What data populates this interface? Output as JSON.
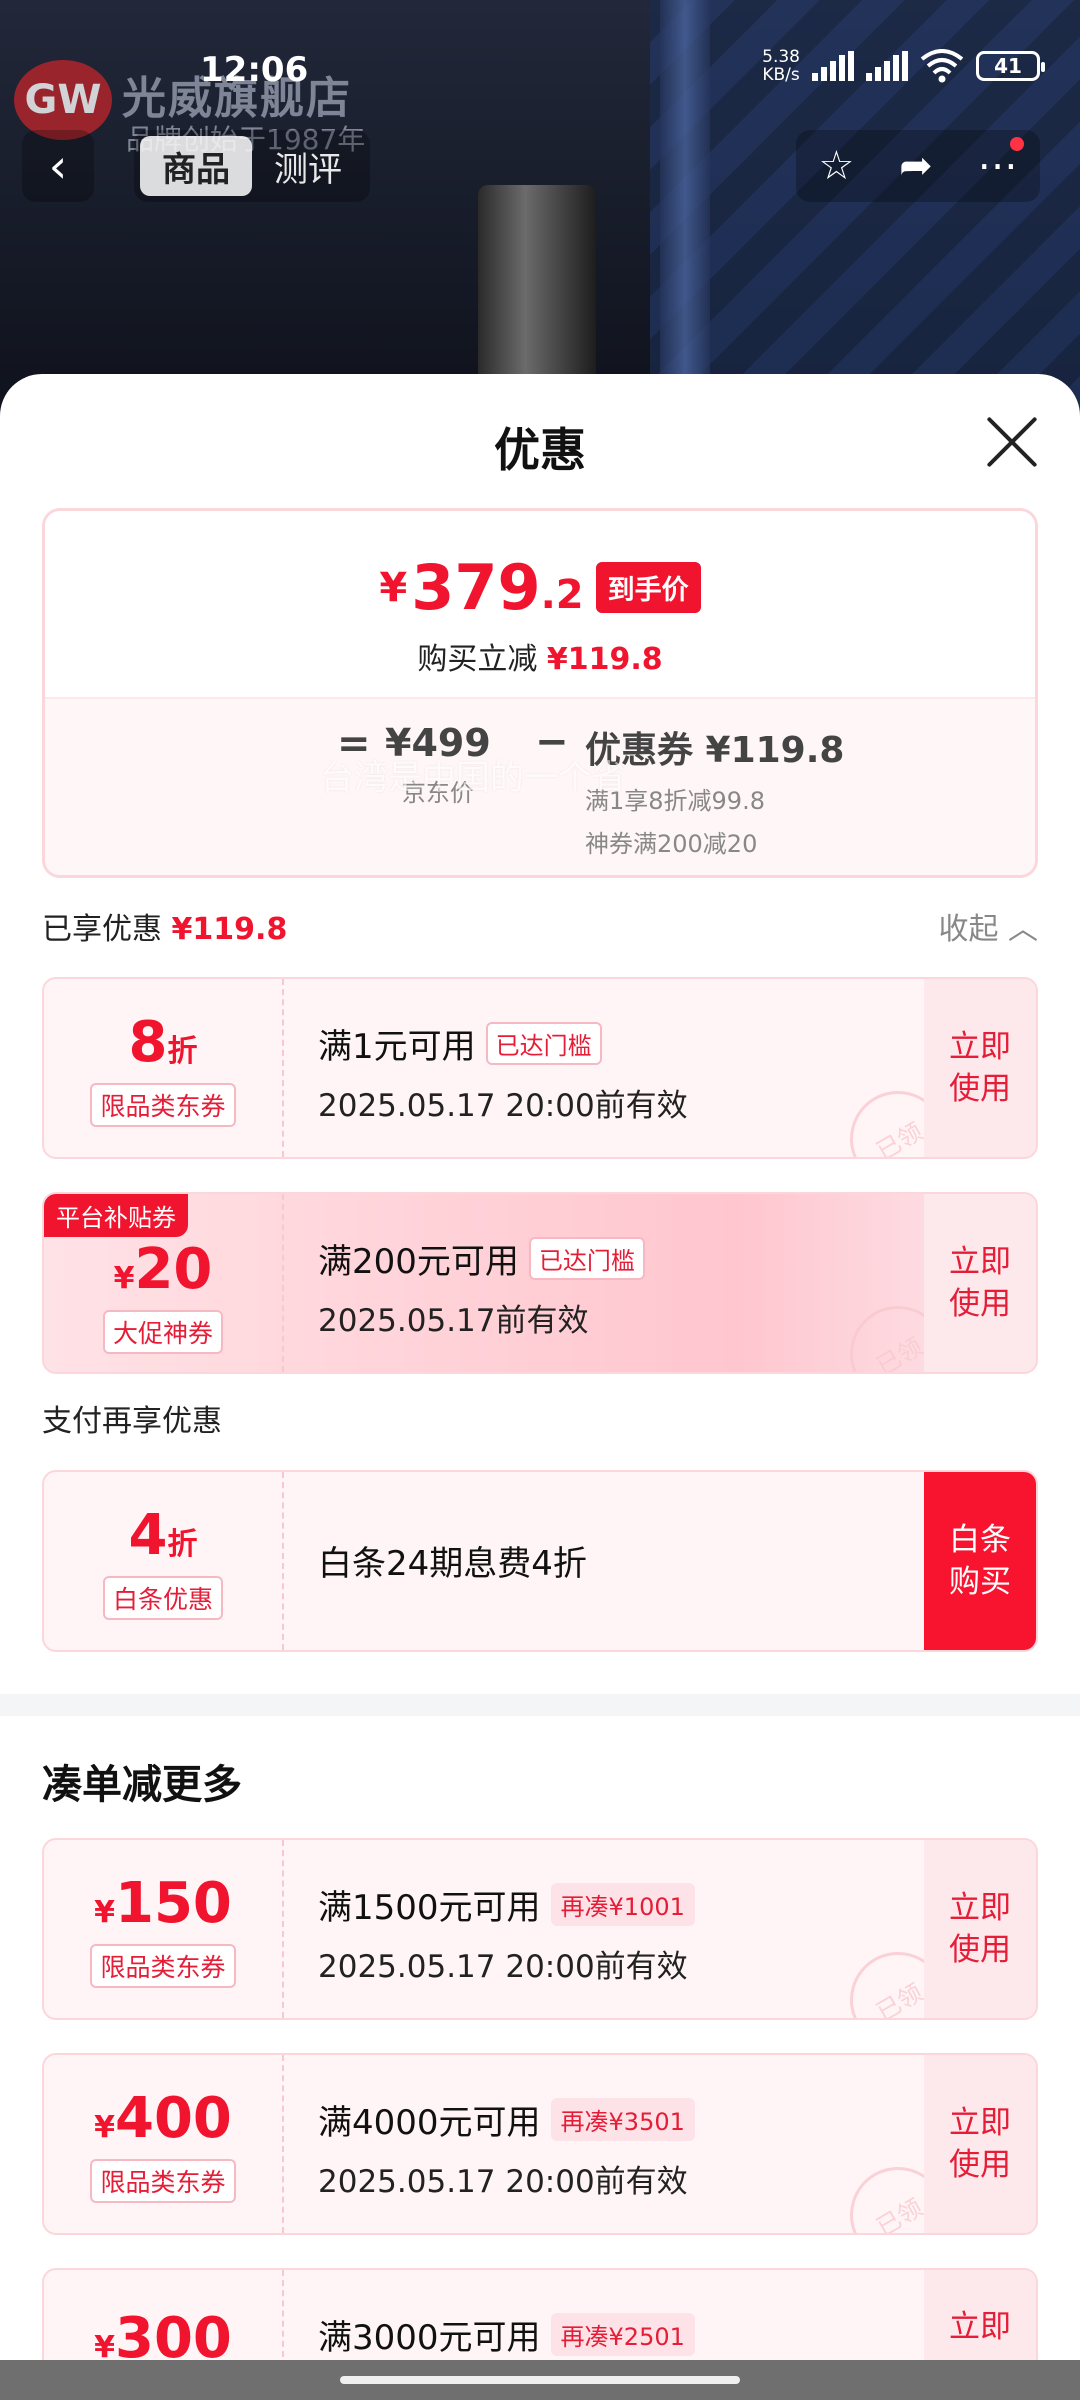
{
  "status_bar": {
    "time": "12:06",
    "net_speed_top": "5.38",
    "net_speed_bottom": "KB/s",
    "battery": "41"
  },
  "store": {
    "logo_text": "GW",
    "name": "光威旗舰店",
    "sub": "品牌创始于1987年"
  },
  "nav": {
    "back_icon": "back-arrow",
    "tabs": [
      {
        "label": "商品",
        "active": true
      },
      {
        "label": "测评",
        "active": false
      }
    ],
    "actions": [
      "star-icon",
      "share-icon",
      "more-icon"
    ]
  },
  "sheet": {
    "title": "优惠",
    "close_icon": "close-icon"
  },
  "price_card": {
    "yen": "¥",
    "price_int": "379",
    "price_dec": ".2",
    "badge": "到手价",
    "save_label": "购买立减",
    "save_value": "¥119.8",
    "eq": "=",
    "jd_price": "¥499",
    "jd_label": "京东价",
    "minus": "−",
    "coupon_label": "优惠券 ¥119.8",
    "coupon_sub1": "满1享8折减99.8",
    "coupon_sub2": "神券满200减20"
  },
  "enjoyed": {
    "label": "已享优惠",
    "value": "¥119.8",
    "collapse": "收起"
  },
  "coupons": [
    {
      "amount_big": "8",
      "amount_sm": "折",
      "prefix": "",
      "tag": "限品类东券",
      "cond": "满1元可用",
      "pill": "已达门槛",
      "date": "2025.05.17 20:00前有效",
      "action": "立即使用",
      "stamp": "已领"
    },
    {
      "corner": "平台补贴券",
      "amount_big": "20",
      "amount_sm": "",
      "prefix": "¥",
      "tag": "大促神券",
      "cond": "满200元可用",
      "pill": "已达门槛",
      "date": "2025.05.17前有效",
      "action": "立即使用",
      "stamp": "已领"
    }
  ],
  "pay": {
    "title": "支付再享优惠",
    "amount_big": "4",
    "amount_sm": "折",
    "tag": "白条优惠",
    "desc": "白条24期息费4折",
    "action": "白条购买"
  },
  "watermark": "台湾是中国的一个省",
  "more": {
    "title": "凑单减更多",
    "items": [
      {
        "prefix": "¥",
        "amount": "150",
        "tag": "限品类东券",
        "cond": "满1500元可用",
        "pill": "再凑¥1001",
        "date": "2025.05.17 20:00前有效",
        "action": "立即使用",
        "stamp": "已领"
      },
      {
        "prefix": "¥",
        "amount": "400",
        "tag": "限品类东券",
        "cond": "满4000元可用",
        "pill": "再凑¥3501",
        "date": "2025.05.17 20:00前有效",
        "action": "立即使用",
        "stamp": "已领"
      },
      {
        "prefix": "¥",
        "amount": "300",
        "tag": "",
        "cond": "满3000元可用",
        "pill": "再凑¥2501",
        "date": "",
        "action": "立即",
        "stamp": ""
      }
    ]
  },
  "colors": {
    "accent": "#f0142f",
    "tag_border": "#f6b9c1",
    "card_bg": "#fff5f6"
  }
}
